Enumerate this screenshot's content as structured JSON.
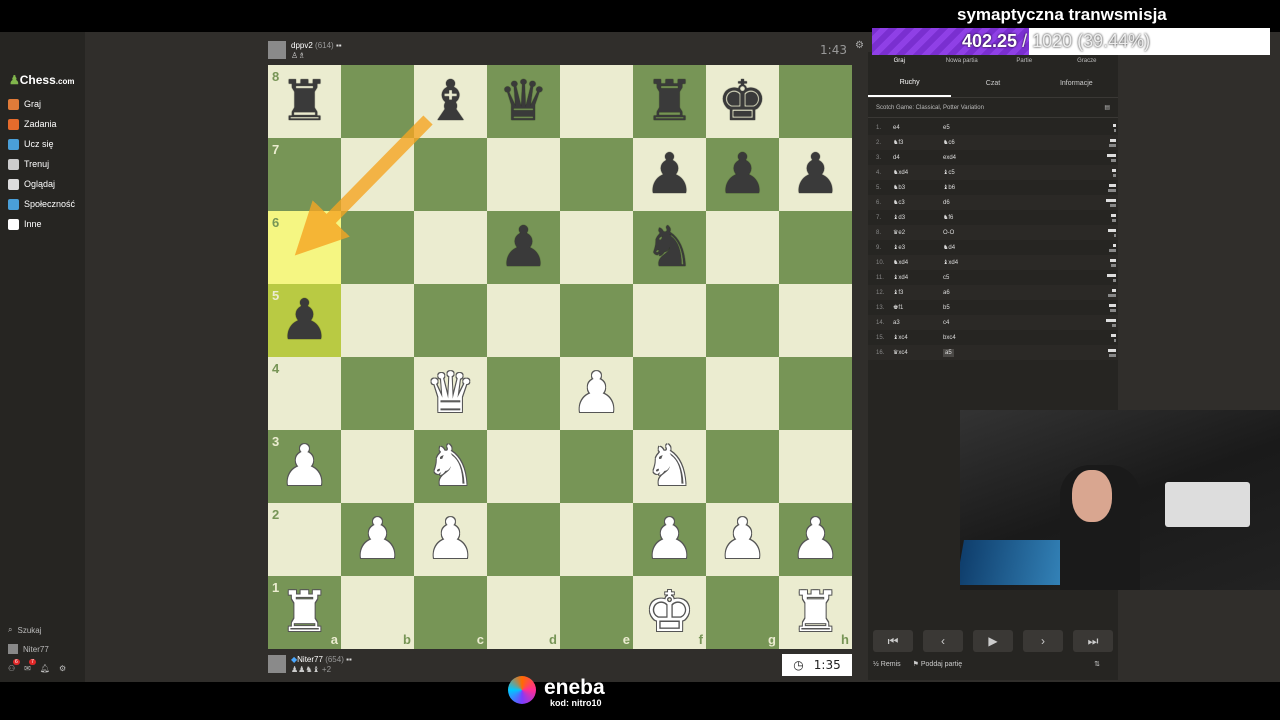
{
  "stream": {
    "title": "symaptyczna tranwsmisja",
    "progress_value": "402.25",
    "progress_goal": "/ 1020 (39.44%)",
    "progress_fraction": 0.3944,
    "progress_color": "#8f40e6"
  },
  "sidebar": {
    "logo_text": "Chess",
    "logo_suffix": ".com",
    "items": [
      {
        "label": "Graj",
        "icon": "play-icon",
        "color": "#e07b39"
      },
      {
        "label": "Zadania",
        "icon": "puzzle-icon",
        "color": "#e56b2c"
      },
      {
        "label": "Ucz się",
        "icon": "learn-icon",
        "color": "#4a9fd8"
      },
      {
        "label": "Trenuj",
        "icon": "train-icon",
        "color": "#cccccc"
      },
      {
        "label": "Oglądaj",
        "icon": "watch-icon",
        "color": "#dddddd"
      },
      {
        "label": "Społeczność",
        "icon": "community-icon",
        "color": "#4a9fd8"
      },
      {
        "label": "Inne",
        "icon": "more-icon",
        "color": "#ffffff"
      }
    ],
    "search_label": "Szukaj",
    "user_label": "Niter77",
    "badge_count": "6",
    "badge_count_2": "7"
  },
  "players": {
    "top": {
      "name": "dppv2",
      "rating": "(614)",
      "clock": "1:43"
    },
    "bottom": {
      "name": "Niter77",
      "rating": "(654)",
      "clock": "1:35",
      "captured_extra": "+2"
    }
  },
  "board": {
    "light_color": "#ebecd0",
    "dark_color": "#779556",
    "highlight_squares": [
      "a6",
      "a5"
    ],
    "arrow": {
      "from": "d8",
      "to": "a6",
      "color": "#f5a623"
    },
    "pieces": {
      "a8": "bR",
      "c8": "bB",
      "d8": "bQ",
      "f8": "bR",
      "g8": "bK",
      "f7": "bP",
      "g7": "bP",
      "h7": "bP",
      "d6": "bP",
      "f6": "bN",
      "a5": "bP",
      "c4": "wQ",
      "e4": "wP",
      "a3": "wP",
      "c3": "wN",
      "f3": "wN",
      "b2": "wP",
      "c2": "wP",
      "f2": "wP",
      "g2": "wP",
      "h2": "wP",
      "a1": "wR",
      "f1": "wK",
      "h1": "wR"
    },
    "ranks": [
      "8",
      "7",
      "6",
      "5",
      "4",
      "3",
      "2",
      "1"
    ],
    "files": [
      "a",
      "b",
      "c",
      "d",
      "e",
      "f",
      "g",
      "h"
    ]
  },
  "panel": {
    "top_tabs": [
      "Graj",
      "Nowa partia",
      "Partie",
      "Gracze"
    ],
    "tabs": [
      "Ruchy",
      "Czat",
      "Informacje"
    ],
    "opening": "Scotch Game: Classical, Potter Variation",
    "moves": [
      {
        "n": "1.",
        "w": "e4",
        "b": "e5"
      },
      {
        "n": "2.",
        "w": "♞f3",
        "b": "♞c6"
      },
      {
        "n": "3.",
        "w": "d4",
        "b": "exd4"
      },
      {
        "n": "4.",
        "w": "♞xd4",
        "b": "♝c5"
      },
      {
        "n": "5.",
        "w": "♞b3",
        "b": "♝b6"
      },
      {
        "n": "6.",
        "w": "♞c3",
        "b": "d6"
      },
      {
        "n": "7.",
        "w": "♝d3",
        "b": "♞f6"
      },
      {
        "n": "8.",
        "w": "♛e2",
        "b": "O-O"
      },
      {
        "n": "9.",
        "w": "♝e3",
        "b": "♞d4"
      },
      {
        "n": "10.",
        "w": "♞xd4",
        "b": "♝xd4"
      },
      {
        "n": "11.",
        "w": "♝xd4",
        "b": "c5"
      },
      {
        "n": "12.",
        "w": "♝f3",
        "b": "a6"
      },
      {
        "n": "13.",
        "w": "♚f1",
        "b": "b5"
      },
      {
        "n": "14.",
        "w": "a3",
        "b": "c4"
      },
      {
        "n": "15.",
        "w": "♝xc4",
        "b": "bxc4"
      },
      {
        "n": "16.",
        "w": "♛xc4",
        "b": "a5"
      }
    ],
    "controls": [
      "⏮",
      "‹",
      "▶",
      "›",
      "⏭"
    ],
    "draw_label": "Remis",
    "resign_label": "Poddaj partię"
  },
  "sponsor": {
    "name": "eneba",
    "code": "kod: nitro10"
  }
}
